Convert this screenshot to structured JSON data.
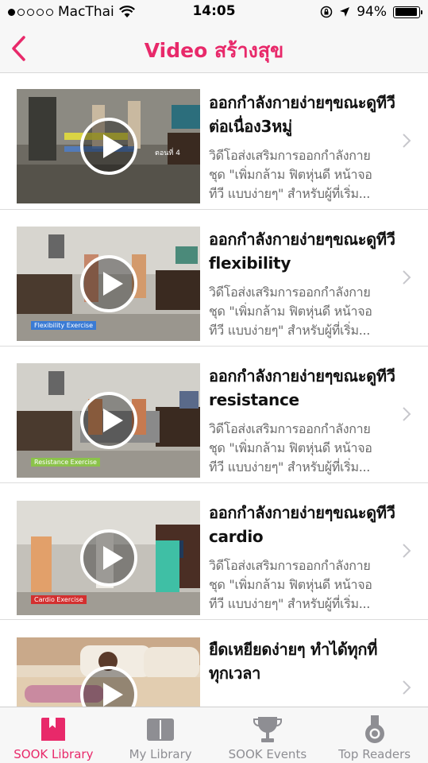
{
  "status_bar": {
    "carrier": "MacThai",
    "time": "14:05",
    "battery": "94%",
    "battery_level": 0.94,
    "signal_bars": 1
  },
  "nav": {
    "title": "Video สร้างสุข"
  },
  "items": [
    {
      "title": "ออกกำลังกายง่ายๆขณะดูทีวี ต่อเนื่อง3หมู่",
      "description": "วิดีโอส่งเสริมการออกกำลังกายชุด \"เพิ่มกล้าม ฟิตหุ่นดี หน้าจอทีวี แบบง่ายๆ\" สำหรับผู้ที่เริ่ม...",
      "thumb_caption": "ตอนที่ 4"
    },
    {
      "title": "ออกกำลังกายง่ายๆขณะดูทีวี flexibility",
      "description": "วิดีโอส่งเสริมการออกกำลังกายชุด \"เพิ่มกล้าม ฟิตหุ่นดี หน้าจอทีวี แบบง่ายๆ\" สำหรับผู้ที่เริ่ม...",
      "thumb_caption": "Flexibility Exercise"
    },
    {
      "title": "ออกกำลังกายง่ายๆขณะดูทีวี resistance",
      "description": "วิดีโอส่งเสริมการออกกำลังกายชุด \"เพิ่มกล้าม ฟิตหุ่นดี หน้าจอทีวี แบบง่ายๆ\" สำหรับผู้ที่เริ่ม...",
      "thumb_caption": "Resistance Exercise"
    },
    {
      "title": "ออกกำลังกายง่ายๆขณะดูทีวี cardio",
      "description": "วิดีโอส่งเสริมการออกกำลังกายชุด \"เพิ่มกล้าม ฟิตหุ่นดี หน้าจอทีวี แบบง่ายๆ\" สำหรับผู้ที่เริ่ม...",
      "thumb_caption": "Cardio Exercise"
    },
    {
      "title": "ยืดเหยียดง่ายๆ ทำได้ทุกที่ ทุกเวลา",
      "description": "",
      "thumb_caption": ""
    }
  ],
  "tabs": [
    {
      "label": "SOOK Library",
      "icon": "bookmark-book-icon",
      "active": true
    },
    {
      "label": "My Library",
      "icon": "open-book-icon",
      "active": false
    },
    {
      "label": "SOOK Events",
      "icon": "trophy-icon",
      "active": false
    },
    {
      "label": "Top Readers",
      "icon": "medal-icon",
      "active": false
    }
  ],
  "colors": {
    "accent": "#e8296a",
    "tab_inactive": "#8e8e93",
    "caption_flex": "#3a7bd5",
    "caption_resist": "#8bc34a",
    "caption_cardio": "#d32f2f"
  }
}
